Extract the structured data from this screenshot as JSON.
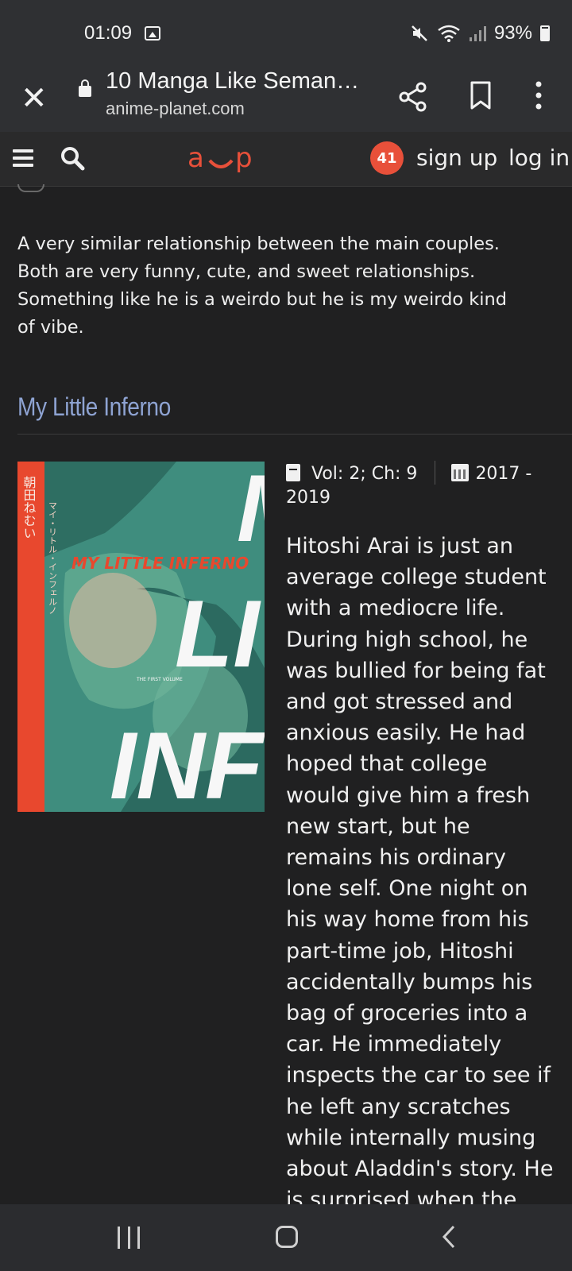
{
  "status_bar": {
    "time": "01:09",
    "battery": "93%",
    "icons": [
      "gallery-icon",
      "mute-icon",
      "wifi-icon",
      "signal-icon",
      "battery-icon"
    ]
  },
  "browser": {
    "page_title": "10 Manga Like Seman…",
    "domain": "anime-planet.com",
    "icons": [
      "close-icon",
      "lock-icon",
      "share-icon",
      "bookmark-icon",
      "more-options-icon"
    ]
  },
  "site_nav": {
    "logo": "a‿p",
    "notification_count": "41",
    "sign_up": "sign up",
    "log_in": "log in"
  },
  "previous_entry": {
    "review": "A very similar relationship between the main couples. Both are very funny, cute, and sweet relationships. Something like he is a weirdo but he is my weirdo kind of vibe."
  },
  "entry": {
    "title": "My Little Inferno",
    "volumes": "Vol: 2; Ch: 9",
    "years": "2017 - 2019",
    "cover_text": {
      "title": "MY LITTLE INFERNO",
      "big_letters": [
        "M",
        "LIT",
        "INFE"
      ],
      "subtitle": "THE FIRST VOLUME",
      "vertical_jp": "マイ・リトル・インフェルノ",
      "author_jp": "朝田ねむい"
    },
    "synopsis": "Hitoshi Arai is just an average college student with a mediocre life. During high school, he was bullied for being fat and got stressed and anxious easily. He had hoped that college would give him a fresh new start, but he remains his ordinary lone self. One night on his way home from his part-time job, Hitoshi accidentally bumps his bag of groceries into a car. He immediately inspects the car to see if he left any scratches while internally musing about Aladdin's story. He is surprised when the trunk of the car"
  },
  "colors": {
    "background": "#202021",
    "heading": "#8ea3d2",
    "accent": "#e8503a",
    "cover_red": "#e8482e",
    "cover_teal": "#3f8d7e"
  },
  "system_nav": {
    "icons": [
      "recents-icon",
      "home-icon",
      "back-icon"
    ]
  }
}
